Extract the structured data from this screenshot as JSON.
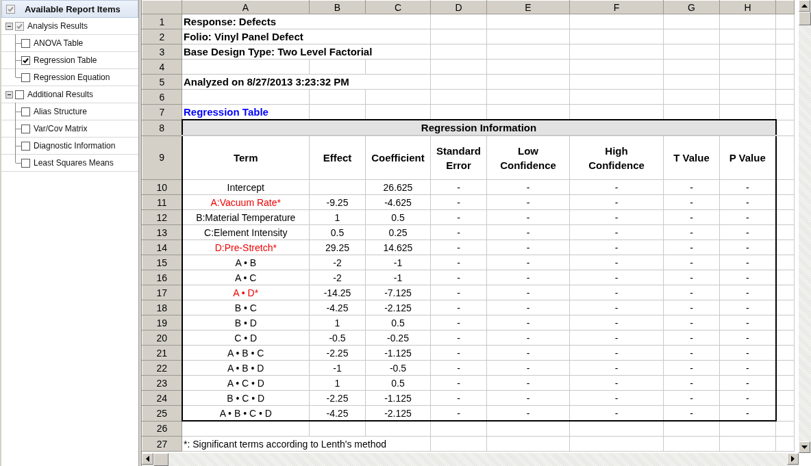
{
  "sidebar": {
    "header": {
      "label": "Available Report Items",
      "checked": true,
      "partial": true
    },
    "groups": [
      {
        "label": "Analysis Results",
        "checked": true,
        "partial": true,
        "expanded": true,
        "children": [
          {
            "label": "ANOVA Table",
            "checked": false
          },
          {
            "label": "Regression Table",
            "checked": true
          },
          {
            "label": "Regression Equation",
            "checked": false
          }
        ]
      },
      {
        "label": "Additional Results",
        "checked": false,
        "partial": false,
        "expanded": true,
        "children": [
          {
            "label": "Alias Structure",
            "checked": false
          },
          {
            "label": "Var/Cov Matrix",
            "checked": false
          },
          {
            "label": "Diagnostic Information",
            "checked": false
          },
          {
            "label": "Least Squares Means",
            "checked": false
          }
        ]
      }
    ]
  },
  "sheet": {
    "columns": [
      "A",
      "B",
      "C",
      "D",
      "E",
      "F",
      "G",
      "H"
    ],
    "rows": [
      {
        "number": "1",
        "kind": "info",
        "text": "Response: Defects"
      },
      {
        "number": "2",
        "kind": "info",
        "text": "Folio: Vinyl Panel Defect"
      },
      {
        "number": "3",
        "kind": "info",
        "text": "Base Design Type: Two Level Factorial"
      },
      {
        "number": "4",
        "kind": "blank"
      },
      {
        "number": "5",
        "kind": "info",
        "text": "Analyzed on 8/27/2013 3:23:32 PM"
      },
      {
        "number": "6",
        "kind": "blank"
      },
      {
        "number": "7",
        "kind": "title",
        "text": "Regression Table"
      },
      {
        "number": "8",
        "kind": "table_title",
        "caption": "Regression Information"
      },
      {
        "number": "9",
        "kind": "table_header",
        "cells": [
          "Term",
          "Effect",
          "Coefficient",
          "Standard Error",
          "Low Confidence",
          "High Confidence",
          "T Value",
          "P Value"
        ]
      },
      {
        "number": "10",
        "kind": "data",
        "significant": false,
        "cells": [
          "Intercept",
          "",
          "26.625",
          "-",
          "-",
          "-",
          "-",
          "-"
        ]
      },
      {
        "number": "11",
        "kind": "data",
        "significant": true,
        "cells": [
          "A:Vacuum Rate*",
          "-9.25",
          "-4.625",
          "-",
          "-",
          "-",
          "-",
          "-"
        ]
      },
      {
        "number": "12",
        "kind": "data",
        "significant": false,
        "cells": [
          "B:Material Temperature",
          "1",
          "0.5",
          "-",
          "-",
          "-",
          "-",
          "-"
        ]
      },
      {
        "number": "13",
        "kind": "data",
        "significant": false,
        "cells": [
          "C:Element Intensity",
          "0.5",
          "0.25",
          "-",
          "-",
          "-",
          "-",
          "-"
        ]
      },
      {
        "number": "14",
        "kind": "data",
        "significant": true,
        "cells": [
          "D:Pre-Stretch*",
          "29.25",
          "14.625",
          "-",
          "-",
          "-",
          "-",
          "-"
        ]
      },
      {
        "number": "15",
        "kind": "data",
        "significant": false,
        "cells": [
          "A • B",
          "-2",
          "-1",
          "-",
          "-",
          "-",
          "-",
          "-"
        ]
      },
      {
        "number": "16",
        "kind": "data",
        "significant": false,
        "cells": [
          "A • C",
          "-2",
          "-1",
          "-",
          "-",
          "-",
          "-",
          "-"
        ]
      },
      {
        "number": "17",
        "kind": "data",
        "significant": true,
        "cells": [
          "A • D*",
          "-14.25",
          "-7.125",
          "-",
          "-",
          "-",
          "-",
          "-"
        ]
      },
      {
        "number": "18",
        "kind": "data",
        "significant": false,
        "cells": [
          "B • C",
          "-4.25",
          "-2.125",
          "-",
          "-",
          "-",
          "-",
          "-"
        ]
      },
      {
        "number": "19",
        "kind": "data",
        "significant": false,
        "cells": [
          "B • D",
          "1",
          "0.5",
          "-",
          "-",
          "-",
          "-",
          "-"
        ]
      },
      {
        "number": "20",
        "kind": "data",
        "significant": false,
        "cells": [
          "C • D",
          "-0.5",
          "-0.25",
          "-",
          "-",
          "-",
          "-",
          "-"
        ]
      },
      {
        "number": "21",
        "kind": "data",
        "significant": false,
        "cells": [
          "A • B • C",
          "-2.25",
          "-1.125",
          "-",
          "-",
          "-",
          "-",
          "-"
        ]
      },
      {
        "number": "22",
        "kind": "data",
        "significant": false,
        "cells": [
          "A • B • D",
          "-1",
          "-0.5",
          "-",
          "-",
          "-",
          "-",
          "-"
        ]
      },
      {
        "number": "23",
        "kind": "data",
        "significant": false,
        "cells": [
          "A • C • D",
          "1",
          "0.5",
          "-",
          "-",
          "-",
          "-",
          "-"
        ]
      },
      {
        "number": "24",
        "kind": "data",
        "significant": false,
        "cells": [
          "B • C • D",
          "-2.25",
          "-1.125",
          "-",
          "-",
          "-",
          "-",
          "-"
        ]
      },
      {
        "number": "25",
        "kind": "data",
        "significant": false,
        "cells": [
          "A • B • C • D",
          "-4.25",
          "-2.125",
          "-",
          "-",
          "-",
          "-",
          "-"
        ]
      },
      {
        "number": "26",
        "kind": "blank"
      },
      {
        "number": "27",
        "kind": "note",
        "text": "*: Significant terms according to Lenth's method"
      }
    ]
  }
}
